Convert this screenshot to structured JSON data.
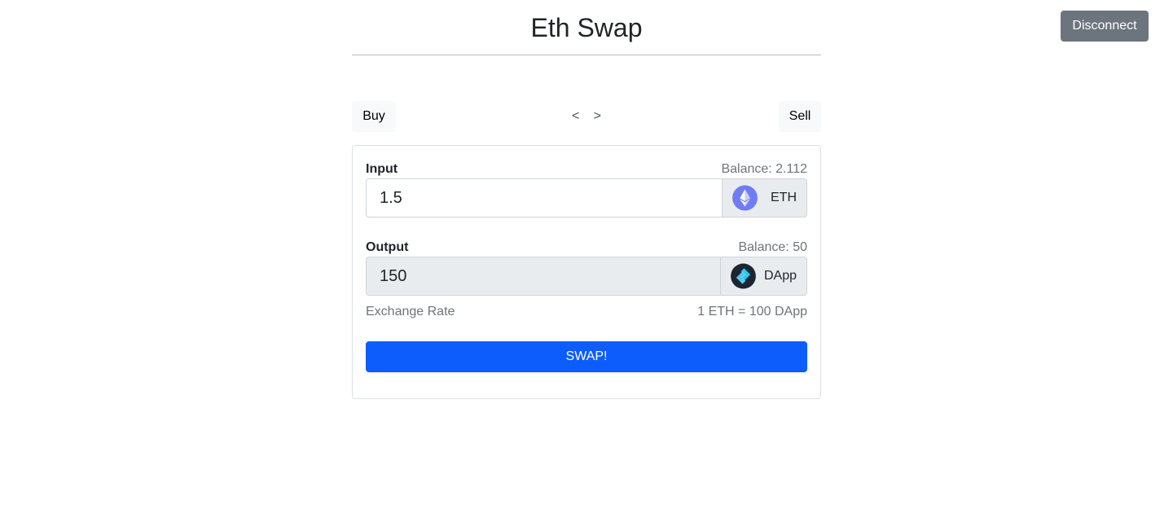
{
  "header": {
    "title": "Eth Swap",
    "disconnect_label": "Disconnect"
  },
  "tabs": {
    "buy_label": "Buy",
    "sell_label": "Sell",
    "prev_arrow": "<",
    "next_arrow": ">"
  },
  "swap_form": {
    "input": {
      "label": "Input",
      "balance": "Balance: 2.112",
      "value": "1.5",
      "token": "ETH",
      "token_icon": "ethereum-icon"
    },
    "output": {
      "label": "Output",
      "balance": "Balance: 50",
      "value": "150",
      "token": "DApp",
      "token_icon": "dapp-token-icon"
    },
    "exchange_rate_label": "Exchange Rate",
    "exchange_rate_value": "1 ETH = 100 DApp",
    "swap_label": "SWAP!"
  },
  "colors": {
    "primary": "#0d5dfd",
    "secondary": "#6c757d",
    "eth_icon": "#6f7cf5",
    "dapp_icon_bg": "#1c2532",
    "dapp_icon_fg": "#2fc6f2"
  }
}
